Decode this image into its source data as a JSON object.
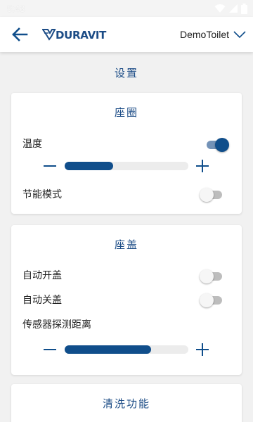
{
  "status_bar": {
    "time": "5:43"
  },
  "header": {
    "logo_text": "DURAVIT",
    "device_name": "DemoToilet"
  },
  "page": {
    "section_title": "设置"
  },
  "seat_card": {
    "title": "座圈",
    "temperature_label": "温度",
    "temperature_toggle_on": true,
    "temperature_level": 0.39,
    "eco_label": "节能模式",
    "eco_toggle_on": false
  },
  "lid_card": {
    "title": "座盖",
    "auto_open_label": "自动开盖",
    "auto_open_on": false,
    "auto_close_label": "自动关盖",
    "auto_close_on": false,
    "sensor_label": "传感器探测距离",
    "sensor_level": 0.7
  },
  "wash_card": {
    "title": "清洗功能"
  },
  "colors": {
    "brand": "#104e8b",
    "title_text": "#1c4c86",
    "toggle_off": "#bdbdbd"
  },
  "icons": {
    "back": "arrow-left-icon",
    "dropdown": "chevron-down-icon",
    "minus": "minus-icon",
    "plus": "plus-icon",
    "wifi": "wifi-icon",
    "signal": "signal-icon",
    "battery": "battery-icon"
  }
}
